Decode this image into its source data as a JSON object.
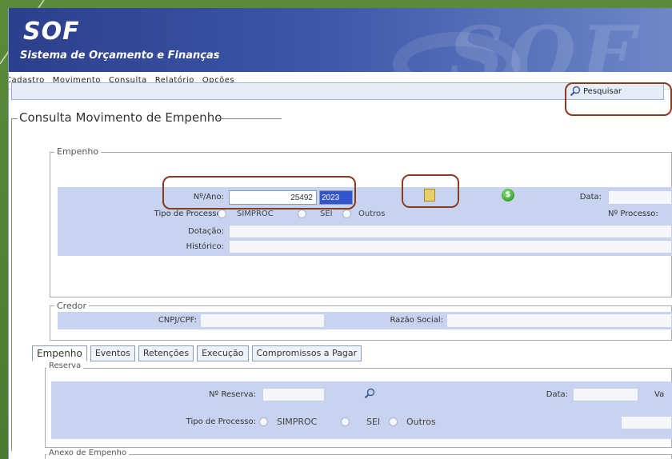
{
  "app": {
    "title": "SOF",
    "subtitle": "Sistema de Orçamento e Finanças",
    "watermark": "SOF"
  },
  "menu": [
    "Cadastro",
    "Movimento",
    "Consulta",
    "Relatório",
    "Opções"
  ],
  "toolbar": {
    "search_label": "Pesquisar"
  },
  "page": {
    "title": "Consulta Movimento de Empenho"
  },
  "empenho": {
    "legend": "Empenho",
    "numero_label": "Nº/Ano:",
    "numero_value": "25492",
    "ano_value": "2023",
    "data_label": "Data:",
    "tipo_processo_label": "Tipo de Processo:",
    "tipo_options": [
      "SIMPROC",
      "SEI",
      "Outros"
    ],
    "nprocesso_label": "Nº Processo:",
    "dotacao_label": "Dotação:",
    "historico_label": "Histórico:"
  },
  "credor": {
    "legend": "Credor",
    "cnpj_label": "CNPJ/CPF:",
    "razao_label": "Razão Social:"
  },
  "tabs": [
    "Empenho",
    "Eventos",
    "Retenções",
    "Execução",
    "Compromissos a Pagar"
  ],
  "reserva": {
    "legend": "Reserva",
    "nreserva_label": "Nº Reserva:",
    "data_label": "Data:",
    "va_label": "Va",
    "tipo_processo_label": "Tipo de Processo:",
    "tipo_options": [
      "SIMPROC",
      "SEI",
      "Outros"
    ]
  },
  "anexo": {
    "legend": "Anexo de Empenho"
  },
  "icons": {
    "search": "magnifier-icon",
    "document_search": "document-search-icon",
    "green_action": "green-circle-icon"
  },
  "colors": {
    "header_dark": "#2c3f8c",
    "form_bg": "#c7d3ef",
    "highlight": "#8a3a1e",
    "selected_input": "#3355cc"
  }
}
